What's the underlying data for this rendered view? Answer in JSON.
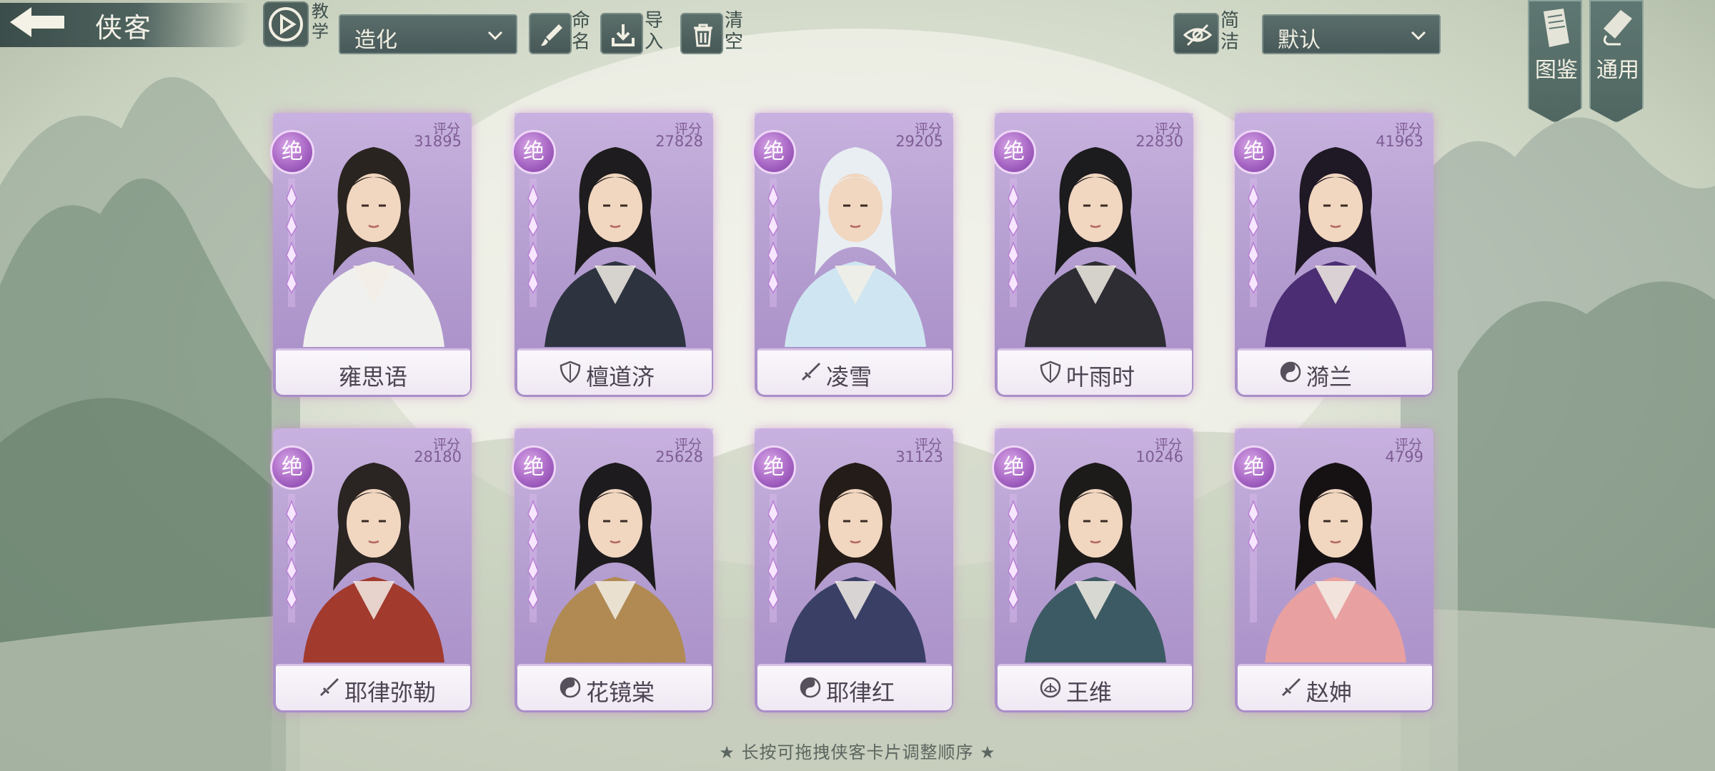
{
  "header": {
    "title": "侠客",
    "tutorial_label": "教学",
    "filter_dropdown": "造化",
    "rename_label": "命名",
    "import_label": "导入",
    "clear_label": "清空",
    "simple_label": "简洁",
    "sort_dropdown": "默认",
    "tab_atlas": "图鉴",
    "tab_general": "通用"
  },
  "score_label": "评分",
  "rank_label": "绝",
  "cards": [
    {
      "name": "雍思语",
      "score": "31895",
      "faction_icon": "none",
      "stars": 4
    },
    {
      "name": "檀道济",
      "score": "27828",
      "faction_icon": "shield-icon",
      "stars": 4
    },
    {
      "name": "凌雪",
      "score": "29205",
      "faction_icon": "sword-icon",
      "stars": 4
    },
    {
      "name": "叶雨时",
      "score": "22830",
      "faction_icon": "shield-icon",
      "stars": 4
    },
    {
      "name": "漪兰",
      "score": "41963",
      "faction_icon": "yin-yang-icon",
      "stars": 4
    },
    {
      "name": "耶律弥勒",
      "score": "28180",
      "faction_icon": "sword-icon",
      "stars": 4
    },
    {
      "name": "花镜棠",
      "score": "25628",
      "faction_icon": "yin-yang-icon",
      "stars": 4
    },
    {
      "name": "耶律红",
      "score": "31123",
      "faction_icon": "yin-yang-icon",
      "stars": 4
    },
    {
      "name": "王维",
      "score": "10246",
      "faction_icon": "lotus-icon",
      "stars": 4
    },
    {
      "name": "赵妽",
      "score": "4799",
      "faction_icon": "sword-icon",
      "stars": 2
    }
  ],
  "hint": "★ 长按可拖拽侠客卡片调整顺序 ★",
  "colors": {
    "accent_purple": "#a766c4",
    "panel_teal": "#4e625e",
    "card_lilac": "#b39ccf"
  }
}
